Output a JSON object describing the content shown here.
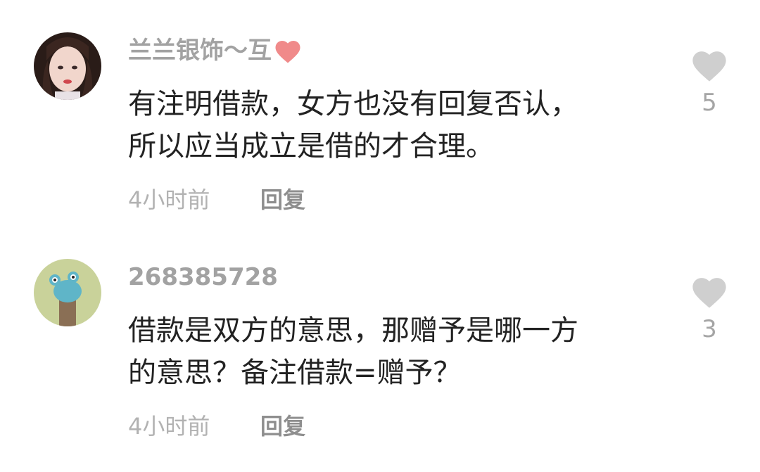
{
  "comments": [
    {
      "username": "兰兰银饰～互",
      "username_badge_icon": "heart-icon",
      "content_lines": [
        "有注明借款，女方也没有回复否认，",
        "所以应当成立是借的才合理。"
      ],
      "time": "4小时前",
      "reply_label": "回复",
      "like_count": "5"
    },
    {
      "username": "268385728",
      "content_lines": [
        "借款是双方的意思，那赠予是哪一方",
        "的意思？备注借款=赠予？"
      ],
      "time": "4小时前",
      "reply_label": "回复",
      "like_count": "3"
    }
  ],
  "colors": {
    "username": "#a2a2a2",
    "content": "#222222",
    "time": "#b2b2b2",
    "reply": "#8e8e8e",
    "like_icon": "#cfcfcf",
    "username_heart": "#f08a8a"
  }
}
